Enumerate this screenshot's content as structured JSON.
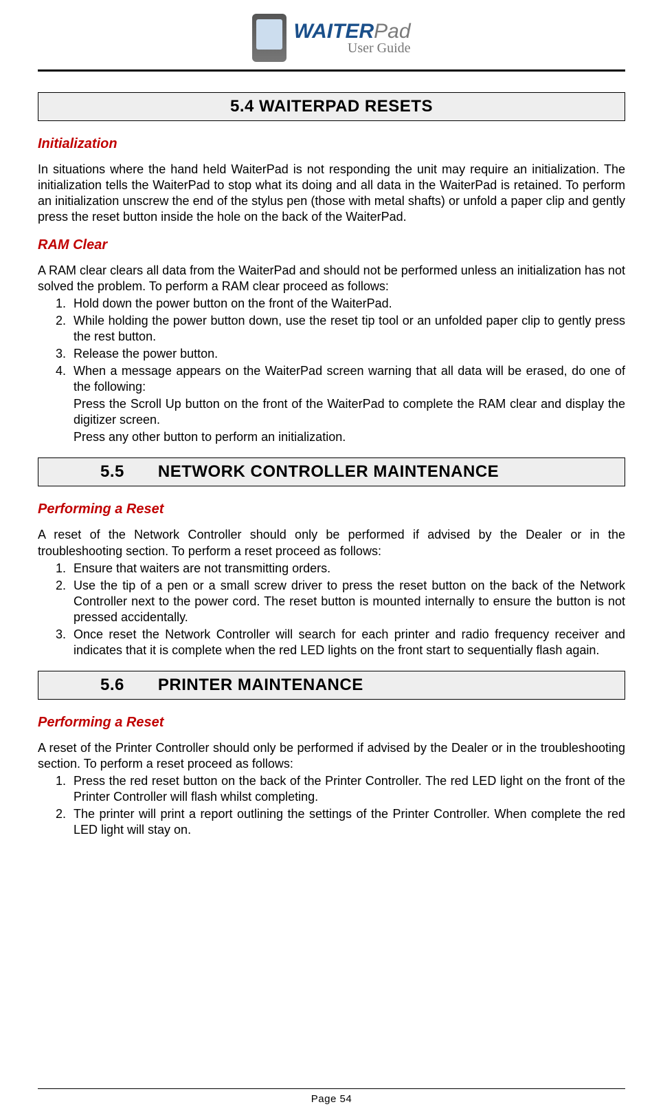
{
  "logo": {
    "title_main": "WAITER",
    "title_pad": "Pad",
    "subtitle": "User Guide"
  },
  "section54": {
    "heading": "5.4 WAITERPAD RESETS",
    "init_heading": "Initialization",
    "init_para": "In situations where the hand held WaiterPad is not responding the unit may require an initialization. The initialization tells the WaiterPad to stop what its doing and all data in the WaiterPad is retained. To perform an initialization unscrew the end of the stylus pen (those with metal shafts) or unfold a paper clip and gently press the reset button inside the hole on the back of the WaiterPad.",
    "ram_heading": "RAM Clear",
    "ram_para": "A RAM clear clears all data from the WaiterPad and should not be performed unless an initialization has not solved the problem. To perform a RAM clear proceed as follows:",
    "ram_list": [
      "Hold down the power button on the front of the WaiterPad.",
      "While holding the power button down, use the reset tip tool or an unfolded paper clip to gently press the rest button.",
      "Release the power button."
    ],
    "ram_item4_line1": "When a message appears on the WaiterPad screen warning that all data will be erased, do one of the following:",
    "ram_item4_line2": "Press the Scroll Up button on the front of the WaiterPad to complete the RAM clear and display the digitizer screen.",
    "ram_item4_line3": "Press any other button to perform an initialization."
  },
  "section55": {
    "heading": "5.5  NETWORK CONTROLLER MAINTENANCE",
    "sub_heading": "Performing a Reset",
    "para": "A reset of the Network Controller should only be performed if advised by the Dealer or in the troubleshooting section. To perform a reset proceed as follows:",
    "list": [
      "Ensure that waiters are not transmitting orders.",
      "Use the tip of a pen or a small screw driver to press the reset button on the back of the Network Controller next to the power cord. The reset button is mounted internally to ensure the button is not pressed accidentally.",
      "Once reset the Network Controller will search for each printer and radio frequency receiver and indicates that it is complete when the red LED lights on the front start to sequentially flash again."
    ]
  },
  "section56": {
    "heading": "5.6  PRINTER MAINTENANCE",
    "sub_heading": "Performing a Reset",
    "para": "A reset of the Printer Controller should only be performed if advised by the Dealer or in the troubleshooting section. To perform a reset proceed as follows:",
    "list": [
      "Press the red reset button on the back of the Printer Controller. The red LED light on the front of the Printer Controller will flash whilst completing.",
      "The printer will print a report outlining the settings of the Printer Controller. When complete the red LED light will stay on."
    ]
  },
  "footer": {
    "page": "Page 54"
  }
}
